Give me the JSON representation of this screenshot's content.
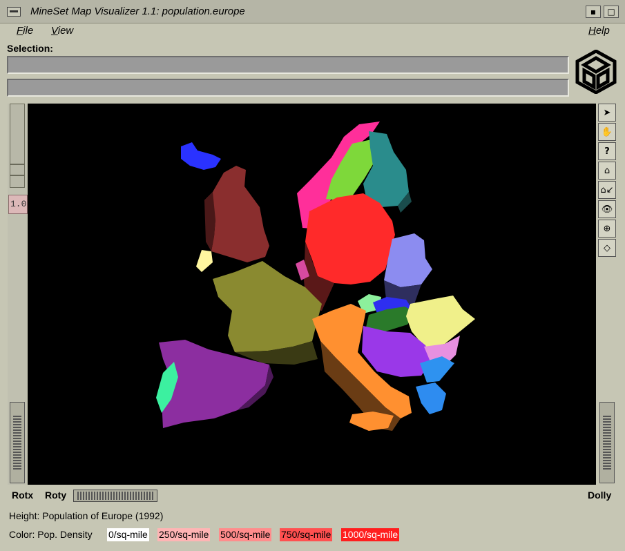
{
  "window": {
    "title": "MineSet Map Visualizer 1.1: population.europe"
  },
  "menu": {
    "file": "File",
    "view": "View",
    "help": "Help"
  },
  "selection": {
    "label": "Selection:",
    "field1": "",
    "field2": ""
  },
  "viewer": {
    "zoom_value": "1.0"
  },
  "tools": [
    "arrow-pointer-icon",
    "hand-icon",
    "question-icon",
    "home-icon",
    "set-home-icon",
    "eye-icon",
    "crosshair-icon",
    "perspective-cube-icon"
  ],
  "controls": {
    "rotx": "Rotx",
    "roty": "Roty",
    "dolly": "Dolly"
  },
  "info": {
    "height": "Height: Population of Europe (1992)",
    "color": "Color: Pop. Density"
  },
  "legend": [
    {
      "label": "0/sq-mile",
      "color": "#ffffff"
    },
    {
      "label": "250/sq-mile",
      "color": "#ffb4b4"
    },
    {
      "label": "500/sq-mile",
      "color": "#ff8c8c"
    },
    {
      "label": "750/sq-mile",
      "color": "#ff5050"
    },
    {
      "label": "1000/sq-mile",
      "color": "#ff1e1e"
    }
  ]
}
